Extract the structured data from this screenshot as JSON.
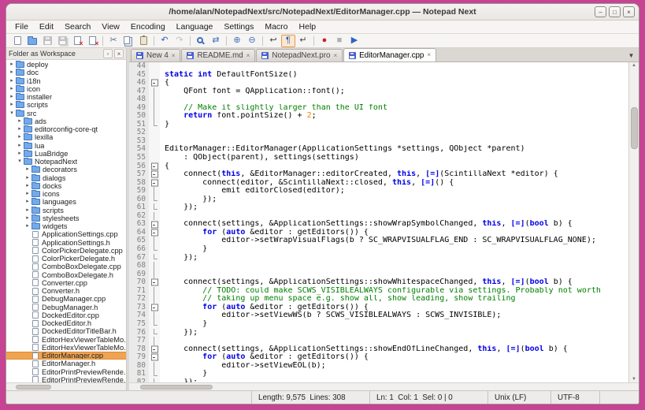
{
  "colors": {
    "window_frame": "#c74394",
    "keyword": "#0000e8",
    "comment": "#008000",
    "number": "#ff8000",
    "selection": "#f0a452"
  },
  "window": {
    "title": "/home/alan/NotepadNext/src/NotepadNext/EditorManager.cpp — Notepad Next",
    "controls": [
      {
        "name": "minimize-button",
        "glyph": "–"
      },
      {
        "name": "maximize-button",
        "glyph": "□"
      },
      {
        "name": "close-button",
        "glyph": "×"
      }
    ]
  },
  "menubar": {
    "items": [
      "File",
      "Edit",
      "Search",
      "View",
      "Encoding",
      "Language",
      "Settings",
      "Macro",
      "Help"
    ]
  },
  "toolbar": {
    "items": [
      {
        "name": "new-file-icon",
        "shape": "page"
      },
      {
        "name": "open-folder-icon",
        "shape": "folder"
      },
      {
        "name": "save-icon",
        "shape": "floppy",
        "disabled": true
      },
      {
        "name": "save-all-icon",
        "shape": "floppy-all",
        "disabled": true
      },
      {
        "name": "close-file-icon",
        "shape": "page-x"
      },
      {
        "name": "close-all-icon",
        "shape": "page-xx"
      },
      {
        "sep": true
      },
      {
        "name": "cut-icon",
        "glyph": "✂",
        "color": "#5a6f8f"
      },
      {
        "name": "copy-icon",
        "shape": "copy"
      },
      {
        "name": "paste-icon",
        "shape": "clip"
      },
      {
        "sep": true
      },
      {
        "name": "undo-icon",
        "glyph": "↶",
        "color": "#2f62c4"
      },
      {
        "name": "redo-icon",
        "glyph": "↷",
        "color": "#2f62c4",
        "disabled": true
      },
      {
        "sep": true
      },
      {
        "name": "find-icon",
        "shape": "mag"
      },
      {
        "name": "replace-icon",
        "glyph": "⇄",
        "color": "#3f6fbf"
      },
      {
        "sep": true
      },
      {
        "name": "zoom-in-icon",
        "glyph": "⊕",
        "color": "#3f6fbf"
      },
      {
        "name": "zoom-out-icon",
        "glyph": "⊖",
        "color": "#3f6fbf"
      },
      {
        "sep": true
      },
      {
        "name": "word-wrap-icon",
        "glyph": "↩",
        "color": "#444444"
      },
      {
        "name": "show-whitespace-icon",
        "glyph": "¶",
        "color": "#2f62c4",
        "active": true
      },
      {
        "name": "show-eol-icon",
        "glyph": "↵",
        "color": "#444444"
      },
      {
        "sep": true
      },
      {
        "name": "record-macro-icon",
        "glyph": "●",
        "color": "#cc2222"
      },
      {
        "name": "stop-macro-icon",
        "glyph": "■",
        "color": "#333333",
        "disabled": true
      },
      {
        "name": "play-macro-icon",
        "glyph": "▶",
        "color": "#2f62c4"
      }
    ]
  },
  "sidebar": {
    "title": "Folder as Workspace",
    "header_icons": [
      {
        "name": "float-panel-icon",
        "glyph": "▫"
      },
      {
        "name": "close-panel-icon",
        "glyph": "×"
      }
    ],
    "tree": [
      {
        "label": "deploy",
        "depth": 0,
        "type": "folder"
      },
      {
        "label": "doc",
        "depth": 0,
        "type": "folder"
      },
      {
        "label": "i18n",
        "depth": 0,
        "type": "folder"
      },
      {
        "label": "icon",
        "depth": 0,
        "type": "folder"
      },
      {
        "label": "installer",
        "depth": 0,
        "type": "folder"
      },
      {
        "label": "scripts",
        "depth": 0,
        "type": "folder"
      },
      {
        "label": "src",
        "depth": 0,
        "type": "folder",
        "expanded": true
      },
      {
        "label": "ads",
        "depth": 1,
        "type": "folder"
      },
      {
        "label": "editorconfig-core-qt",
        "depth": 1,
        "type": "folder"
      },
      {
        "label": "lexilla",
        "depth": 1,
        "type": "folder"
      },
      {
        "label": "lua",
        "depth": 1,
        "type": "folder"
      },
      {
        "label": "LuaBridge",
        "depth": 1,
        "type": "folder"
      },
      {
        "label": "NotepadNext",
        "depth": 1,
        "type": "folder",
        "expanded": true
      },
      {
        "label": "decorators",
        "depth": 2,
        "type": "folder"
      },
      {
        "label": "dialogs",
        "depth": 2,
        "type": "folder"
      },
      {
        "label": "docks",
        "depth": 2,
        "type": "folder"
      },
      {
        "label": "icons",
        "depth": 2,
        "type": "folder"
      },
      {
        "label": "languages",
        "depth": 2,
        "type": "folder"
      },
      {
        "label": "scripts",
        "depth": 2,
        "type": "folder"
      },
      {
        "label": "stylesheets",
        "depth": 2,
        "type": "folder"
      },
      {
        "label": "widgets",
        "depth": 2,
        "type": "folder"
      },
      {
        "label": "ApplicationSettings.cpp",
        "depth": 2,
        "type": "file"
      },
      {
        "label": "ApplicationSettings.h",
        "depth": 2,
        "type": "file"
      },
      {
        "label": "ColorPickerDelegate.cpp",
        "depth": 2,
        "type": "file"
      },
      {
        "label": "ColorPickerDelegate.h",
        "depth": 2,
        "type": "file"
      },
      {
        "label": "ComboBoxDelegate.cpp",
        "depth": 2,
        "type": "file"
      },
      {
        "label": "ComboBoxDelegate.h",
        "depth": 2,
        "type": "file"
      },
      {
        "label": "Converter.cpp",
        "depth": 2,
        "type": "file"
      },
      {
        "label": "Converter.h",
        "depth": 2,
        "type": "file"
      },
      {
        "label": "DebugManager.cpp",
        "depth": 2,
        "type": "file"
      },
      {
        "label": "DebugManager.h",
        "depth": 2,
        "type": "file"
      },
      {
        "label": "DockedEditor.cpp",
        "depth": 2,
        "type": "file"
      },
      {
        "label": "DockedEditor.h",
        "depth": 2,
        "type": "file"
      },
      {
        "label": "DockedEditorTitleBar.h",
        "depth": 2,
        "type": "file"
      },
      {
        "label": "EditorHexViewerTableMo...",
        "depth": 2,
        "type": "file"
      },
      {
        "label": "EditorHexViewerTableMo...",
        "depth": 2,
        "type": "file"
      },
      {
        "label": "EditorManager.cpp",
        "depth": 2,
        "type": "file",
        "selected": true
      },
      {
        "label": "EditorManager.h",
        "depth": 2,
        "type": "file"
      },
      {
        "label": "EditorPrintPreviewRende...",
        "depth": 2,
        "type": "file"
      },
      {
        "label": "EditorPrintPreviewRende...",
        "depth": 2,
        "type": "file"
      }
    ]
  },
  "tabs": {
    "items": [
      {
        "label": "New 4",
        "active": false
      },
      {
        "label": "README.md",
        "active": false
      },
      {
        "label": "NotepadNext.pro",
        "active": false
      },
      {
        "label": "EditorManager.cpp",
        "active": true
      }
    ],
    "list_button_glyph": "▼"
  },
  "editor": {
    "lines": [
      {
        "n": 44,
        "f": "",
        "s": []
      },
      {
        "n": 45,
        "f": "",
        "s": [
          [
            "static int",
            "k"
          ],
          [
            " DefaultFontSize()",
            "t"
          ]
        ]
      },
      {
        "n": 46,
        "f": "b",
        "s": [
          [
            "{",
            "t"
          ]
        ]
      },
      {
        "n": 47,
        "f": "m",
        "s": [
          [
            "    QFont font = QApplication::font();",
            "t"
          ]
        ]
      },
      {
        "n": 48,
        "f": "m",
        "s": []
      },
      {
        "n": 49,
        "f": "m",
        "s": [
          [
            "    ",
            "t"
          ],
          [
            "// Make it slightly larger than the UI font",
            "c"
          ]
        ]
      },
      {
        "n": 50,
        "f": "m",
        "s": [
          [
            "    ",
            "t"
          ],
          [
            "return",
            "k"
          ],
          [
            " font.pointSize() + ",
            "t"
          ],
          [
            "2",
            "n"
          ],
          [
            ";",
            "t"
          ]
        ]
      },
      {
        "n": 51,
        "f": "e",
        "s": [
          [
            "}",
            "t"
          ]
        ]
      },
      {
        "n": 52,
        "f": "",
        "s": []
      },
      {
        "n": 53,
        "f": "",
        "s": []
      },
      {
        "n": 54,
        "f": "",
        "s": [
          [
            "EditorManager::EditorManager(ApplicationSettings *settings, QObject *parent)",
            "t"
          ]
        ]
      },
      {
        "n": 55,
        "f": "",
        "s": [
          [
            "    : QObject(parent), settings(settings)",
            "t"
          ]
        ]
      },
      {
        "n": 56,
        "f": "b",
        "s": [
          [
            "{",
            "t"
          ]
        ]
      },
      {
        "n": 57,
        "f": "b",
        "s": [
          [
            "    connect(",
            "t"
          ],
          [
            "this",
            "k"
          ],
          [
            ", &EditorManager::editorCreated, ",
            "t"
          ],
          [
            "this",
            "k"
          ],
          [
            ", ",
            "t"
          ],
          [
            "[=]",
            "k"
          ],
          [
            "(ScintillaNext *editor) {",
            "t"
          ]
        ]
      },
      {
        "n": 58,
        "f": "b",
        "s": [
          [
            "        connect(editor, &ScintillaNext::closed, ",
            "t"
          ],
          [
            "this",
            "k"
          ],
          [
            ", ",
            "t"
          ],
          [
            "[=]",
            "k"
          ],
          [
            "() {",
            "t"
          ]
        ]
      },
      {
        "n": 59,
        "f": "m",
        "s": [
          [
            "            emit editorClosed(editor);",
            "t"
          ]
        ]
      },
      {
        "n": 60,
        "f": "e",
        "s": [
          [
            "        });",
            "t"
          ]
        ]
      },
      {
        "n": 61,
        "f": "e",
        "s": [
          [
            "    });",
            "t"
          ]
        ]
      },
      {
        "n": 62,
        "f": "m",
        "s": []
      },
      {
        "n": 63,
        "f": "b",
        "s": [
          [
            "    connect(settings, &ApplicationSettings::showWrapSymbolChanged, ",
            "t"
          ],
          [
            "this",
            "k"
          ],
          [
            ", ",
            "t"
          ],
          [
            "[=]",
            "k"
          ],
          [
            "(",
            "t"
          ],
          [
            "bool",
            "k"
          ],
          [
            " b) {",
            "t"
          ]
        ]
      },
      {
        "n": 64,
        "f": "b",
        "s": [
          [
            "        ",
            "t"
          ],
          [
            "for",
            "k"
          ],
          [
            " (",
            "t"
          ],
          [
            "auto",
            "k"
          ],
          [
            " &editor : getEditors()) {",
            "t"
          ]
        ]
      },
      {
        "n": 65,
        "f": "m",
        "s": [
          [
            "            editor->setWrapVisualFlags(b ? SC_WRAPVISUALFLAG_END : SC_WRAPVISUALFLAG_NONE);",
            "t"
          ]
        ]
      },
      {
        "n": 66,
        "f": "e",
        "s": [
          [
            "        }",
            "t"
          ]
        ]
      },
      {
        "n": 67,
        "f": "e",
        "s": [
          [
            "    });",
            "t"
          ]
        ]
      },
      {
        "n": 68,
        "f": "m",
        "s": []
      },
      {
        "n": 69,
        "f": "m",
        "s": []
      },
      {
        "n": 70,
        "f": "b",
        "s": [
          [
            "    connect(settings, &ApplicationSettings::showWhitespaceChanged, ",
            "t"
          ],
          [
            "this",
            "k"
          ],
          [
            ", ",
            "t"
          ],
          [
            "[=]",
            "k"
          ],
          [
            "(",
            "t"
          ],
          [
            "bool",
            "k"
          ],
          [
            " b) {",
            "t"
          ]
        ]
      },
      {
        "n": 71,
        "f": "m",
        "s": [
          [
            "        ",
            "t"
          ],
          [
            "// TODO: could make SCWS_VISIBLEALWAYS configurable via settings. Probably not worth",
            "c"
          ]
        ]
      },
      {
        "n": 72,
        "f": "m",
        "s": [
          [
            "        ",
            "t"
          ],
          [
            "// taking up menu space e.g. show all, show leading, show trailing",
            "c"
          ]
        ]
      },
      {
        "n": 73,
        "f": "b",
        "s": [
          [
            "        ",
            "t"
          ],
          [
            "for",
            "k"
          ],
          [
            " (",
            "t"
          ],
          [
            "auto",
            "k"
          ],
          [
            " &editor : getEditors()) {",
            "t"
          ]
        ]
      },
      {
        "n": 74,
        "f": "m",
        "s": [
          [
            "            editor->setViewWS(b ? SCWS_VISIBLEALWAYS : SCWS_INVISIBLE);",
            "t"
          ]
        ]
      },
      {
        "n": 75,
        "f": "e",
        "s": [
          [
            "        }",
            "t"
          ]
        ]
      },
      {
        "n": 76,
        "f": "e",
        "s": [
          [
            "    });",
            "t"
          ]
        ]
      },
      {
        "n": 77,
        "f": "m",
        "s": []
      },
      {
        "n": 78,
        "f": "b",
        "s": [
          [
            "    connect(settings, &ApplicationSettings::showEndOfLineChanged, ",
            "t"
          ],
          [
            "this",
            "k"
          ],
          [
            ", ",
            "t"
          ],
          [
            "[=]",
            "k"
          ],
          [
            "(",
            "t"
          ],
          [
            "bool",
            "k"
          ],
          [
            " b) {",
            "t"
          ]
        ]
      },
      {
        "n": 79,
        "f": "b",
        "s": [
          [
            "        ",
            "t"
          ],
          [
            "for",
            "k"
          ],
          [
            " (",
            "t"
          ],
          [
            "auto",
            "k"
          ],
          [
            " &editor : getEditors()) {",
            "t"
          ]
        ]
      },
      {
        "n": 80,
        "f": "m",
        "s": [
          [
            "            editor->setViewEOL(b);",
            "t"
          ]
        ]
      },
      {
        "n": 81,
        "f": "e",
        "s": [
          [
            "        }",
            "t"
          ]
        ]
      },
      {
        "n": 82,
        "f": "e",
        "s": [
          [
            "    });",
            "t"
          ]
        ]
      }
    ]
  },
  "statusbar": {
    "sections": [
      {
        "name": "doc-type",
        "text": ""
      },
      {
        "name": "length-lines",
        "text": "Length: 9,575  Lines: 308"
      },
      {
        "name": "cursor-position",
        "text": "Ln: 1  Col: 1  Sel: 0 | 0"
      },
      {
        "name": "eol-format",
        "text": "Unix (LF)"
      },
      {
        "name": "encoding",
        "text": "UTF-8"
      },
      {
        "name": "insert-mode",
        "text": ""
      }
    ]
  }
}
